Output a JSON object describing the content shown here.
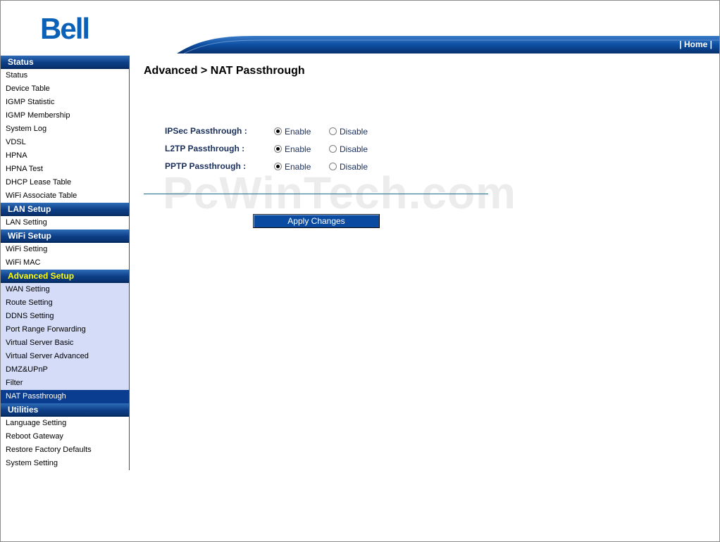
{
  "header": {
    "logo": "Bell",
    "home_link": "| Home |"
  },
  "sidebar": {
    "sections": [
      {
        "title": "Status",
        "active": false,
        "items": [
          "Status",
          "Device Table",
          "IGMP Statistic",
          "IGMP Membership",
          "System Log",
          "VDSL",
          "HPNA",
          "HPNA Test",
          "DHCP Lease Table",
          "WiFi Associate Table"
        ]
      },
      {
        "title": "LAN Setup",
        "active": false,
        "items": [
          "LAN Setting"
        ]
      },
      {
        "title": "WiFi Setup",
        "active": false,
        "items": [
          "WiFi Setting",
          "WiFi MAC"
        ]
      },
      {
        "title": "Advanced Setup",
        "active": true,
        "items": [
          "WAN Setting",
          "Route Setting",
          "DDNS Setting",
          "Port Range Forwarding",
          "Virtual Server Basic",
          "Virtual Server Advanced",
          "DMZ&UPnP",
          "Filter",
          "NAT Passthrough"
        ],
        "selected": "NAT Passthrough"
      },
      {
        "title": "Utilities",
        "active": false,
        "items": [
          "Language Setting",
          "Reboot Gateway",
          "Restore Factory Defaults",
          "System Setting"
        ]
      }
    ]
  },
  "main": {
    "title": "Advanced > NAT Passthrough",
    "watermark": "PcWinTech.com",
    "settings": [
      {
        "label": "IPSec Passthrough :",
        "enable": "Enable",
        "disable": "Disable",
        "value": "enable"
      },
      {
        "label": "L2TP Passthrough :",
        "enable": "Enable",
        "disable": "Disable",
        "value": "enable"
      },
      {
        "label": "PPTP Passthrough :",
        "enable": "Enable",
        "disable": "Disable",
        "value": "enable"
      }
    ],
    "apply_label": "Apply Changes"
  },
  "colors": {
    "bell_blue": "#0b61b8",
    "nav_dark": "#0a3d8f",
    "active_section_text": "#ffff00",
    "active_group_bg": "#d4dcf7"
  }
}
